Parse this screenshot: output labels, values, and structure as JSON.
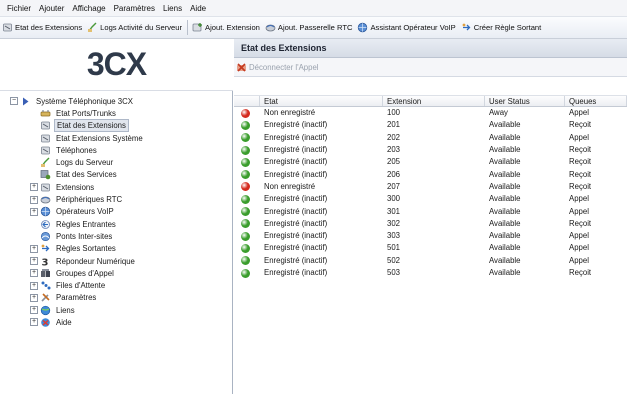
{
  "menu": [
    "Fichier",
    "Ajouter",
    "Affichage",
    "Paramètres",
    "Liens",
    "Aide"
  ],
  "toolbar": [
    {
      "label": "Etat des Extensions",
      "icon": "phone-icon"
    },
    {
      "label": "Logs Activité du Serveur",
      "icon": "log-icon"
    },
    {
      "label": "Ajout. Extension",
      "icon": "phone-add-icon"
    },
    {
      "label": "Ajout. Passerelle RTC",
      "icon": "gateway-icon"
    },
    {
      "label": "Assistant Opérateur VoIP",
      "icon": "globe-icon"
    },
    {
      "label": "Créer Règle Sortant",
      "icon": "rule-icon"
    }
  ],
  "logo": "3CX",
  "tree": [
    {
      "label": "Système Téléphonique 3CX",
      "level": 0,
      "expander": "−",
      "icon": "arrow-icon"
    },
    {
      "label": "Etat Ports/Trunks",
      "level": 1,
      "expander": "",
      "icon": "port-icon"
    },
    {
      "label": "Etat des Extensions",
      "level": 1,
      "expander": "",
      "icon": "phone-icon",
      "selected": true
    },
    {
      "label": "Etat Extensions Système",
      "level": 1,
      "expander": "",
      "icon": "phone-icon"
    },
    {
      "label": "Téléphones",
      "level": 1,
      "expander": "",
      "icon": "phone-icon"
    },
    {
      "label": "Logs du Serveur",
      "level": 1,
      "expander": "",
      "icon": "log-icon"
    },
    {
      "label": "Etat des Services",
      "level": 1,
      "expander": "",
      "icon": "services-icon"
    },
    {
      "label": "Extensions",
      "level": 1,
      "expander": "+",
      "icon": "phone-icon"
    },
    {
      "label": "Périphériques RTC",
      "level": 1,
      "expander": "+",
      "icon": "gateway-icon"
    },
    {
      "label": "Opérateurs VoIP",
      "level": 1,
      "expander": "+",
      "icon": "globe-icon"
    },
    {
      "label": "Règles Entrantes",
      "level": 1,
      "expander": "",
      "icon": "rule-in-icon"
    },
    {
      "label": "Ponts Inter-sites",
      "level": 1,
      "expander": "",
      "icon": "bridge-icon"
    },
    {
      "label": "Règles Sortantes",
      "level": 1,
      "expander": "+",
      "icon": "rule-icon"
    },
    {
      "label": "Répondeur Numérique",
      "level": 1,
      "expander": "+",
      "icon": "ivr-icon"
    },
    {
      "label": "Groupes d'Appel",
      "level": 1,
      "expander": "+",
      "icon": "group-icon"
    },
    {
      "label": "Files d'Attente",
      "level": 1,
      "expander": "+",
      "icon": "queue-icon"
    },
    {
      "label": "Paramètres",
      "level": 1,
      "expander": "+",
      "icon": "settings-icon"
    },
    {
      "label": "Liens",
      "level": 1,
      "expander": "+",
      "icon": "links-icon"
    },
    {
      "label": "Aide",
      "level": 1,
      "expander": "+",
      "icon": "help-icon"
    }
  ],
  "panel": {
    "title": "Etat des Extensions",
    "disconnect_label": "Déconnecter l'Appel"
  },
  "table": {
    "columns": [
      "Etat",
      "Extension",
      "User Status",
      "Queues"
    ],
    "rows": [
      {
        "status": "red",
        "etat": "Non enregistré",
        "ext": "100",
        "user_status": "Away",
        "queues": "Appel"
      },
      {
        "status": "green",
        "etat": "Enregistré (inactif)",
        "ext": "201",
        "user_status": "Available",
        "queues": "Reçoit"
      },
      {
        "status": "green",
        "etat": "Enregistré (inactif)",
        "ext": "202",
        "user_status": "Available",
        "queues": "Appel"
      },
      {
        "status": "green",
        "etat": "Enregistré (inactif)",
        "ext": "203",
        "user_status": "Available",
        "queues": "Reçoit"
      },
      {
        "status": "green",
        "etat": "Enregistré (inactif)",
        "ext": "205",
        "user_status": "Available",
        "queues": "Reçoit"
      },
      {
        "status": "green",
        "etat": "Enregistré (inactif)",
        "ext": "206",
        "user_status": "Available",
        "queues": "Reçoit"
      },
      {
        "status": "red",
        "etat": "Non enregistré",
        "ext": "207",
        "user_status": "Available",
        "queues": "Reçoit"
      },
      {
        "status": "green",
        "etat": "Enregistré (inactif)",
        "ext": "300",
        "user_status": "Available",
        "queues": "Appel"
      },
      {
        "status": "green",
        "etat": "Enregistré (inactif)",
        "ext": "301",
        "user_status": "Available",
        "queues": "Appel"
      },
      {
        "status": "green",
        "etat": "Enregistré (inactif)",
        "ext": "302",
        "user_status": "Available",
        "queues": "Reçoit"
      },
      {
        "status": "green",
        "etat": "Enregistré (inactif)",
        "ext": "303",
        "user_status": "Available",
        "queues": "Appel"
      },
      {
        "status": "green",
        "etat": "Enregistré (inactif)",
        "ext": "501",
        "user_status": "Available",
        "queues": "Appel"
      },
      {
        "status": "green",
        "etat": "Enregistré (inactif)",
        "ext": "502",
        "user_status": "Available",
        "queues": "Appel"
      },
      {
        "status": "green",
        "etat": "Enregistré (inactif)",
        "ext": "503",
        "user_status": "Available",
        "queues": "Reçoit"
      }
    ]
  },
  "colors": {
    "status_red": "#d42a1e",
    "status_green": "#3a9d2c",
    "selection": "#e1e6ee"
  }
}
